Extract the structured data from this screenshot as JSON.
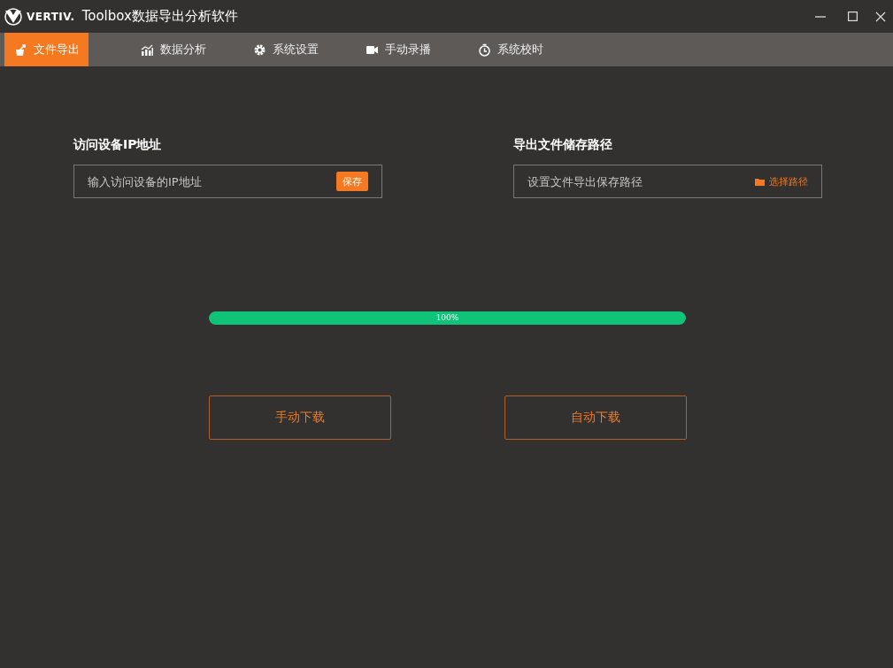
{
  "window": {
    "brand": "VERTIV.",
    "title": "Toolbox数据导出分析软件"
  },
  "tabs": [
    {
      "label": "文件导出",
      "selected": true
    },
    {
      "label": "数据分析",
      "selected": false
    },
    {
      "label": "系统设置",
      "selected": false
    },
    {
      "label": "手动录播",
      "selected": false
    },
    {
      "label": "系统校时",
      "selected": false
    }
  ],
  "ip_section": {
    "label": "访问设备IP地址",
    "placeholder": "输入访问设备的IP地址",
    "button": "保存"
  },
  "path_section": {
    "label": "导出文件储存路径",
    "placeholder": "设置文件导出保存路径",
    "button": "选择路径"
  },
  "progress": {
    "level": 1,
    "reading": "100%"
  },
  "buttons": [
    "手动下载",
    "自动下载"
  ]
}
